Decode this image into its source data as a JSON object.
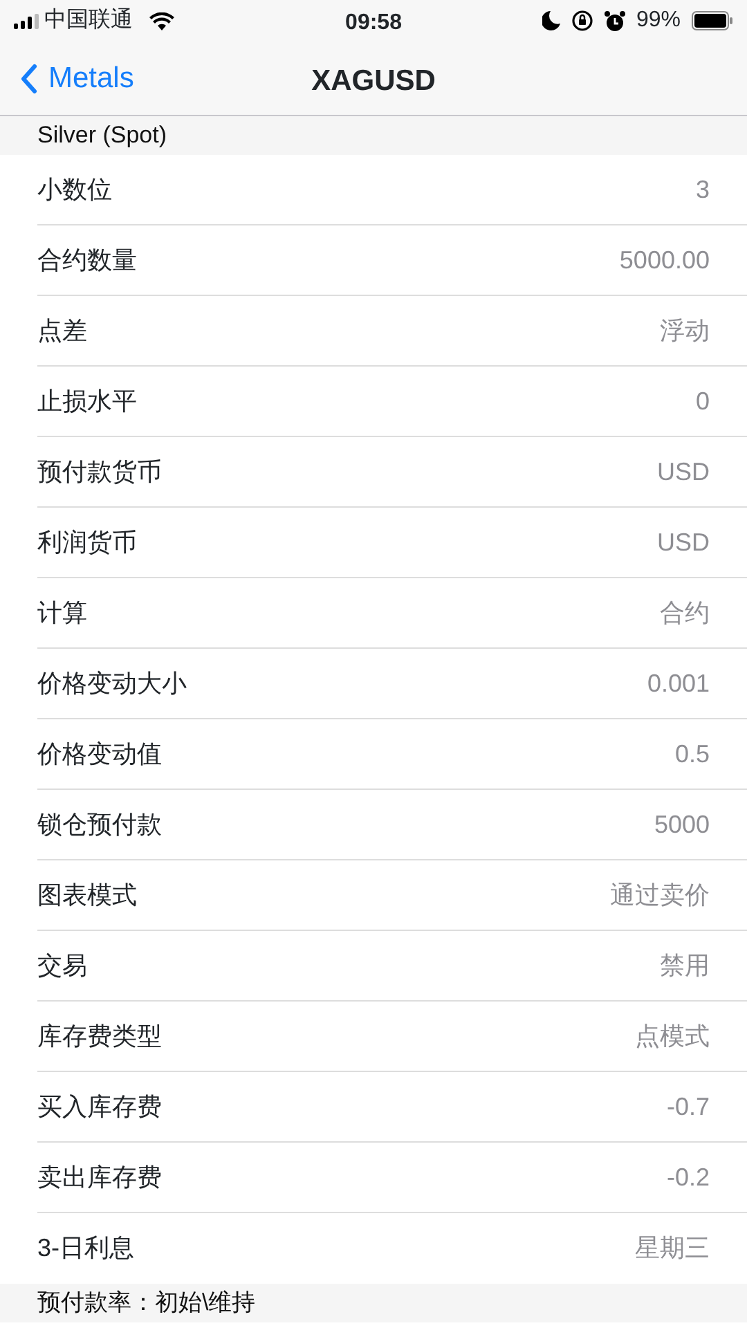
{
  "status_bar": {
    "carrier": "中国联通",
    "time": "09:58",
    "battery": "99%"
  },
  "nav_bar": {
    "back": "Metals",
    "title": "XAGUSD"
  },
  "sections": [
    {
      "header": "Silver (Spot)",
      "rows": [
        {
          "label": "小数位",
          "value": "3"
        },
        {
          "label": "合约数量",
          "value": "5000.00"
        },
        {
          "label": "点差",
          "value": "浮动"
        },
        {
          "label": "止损水平",
          "value": "0"
        },
        {
          "label": "预付款货币",
          "value": "USD"
        },
        {
          "label": "利润货币",
          "value": "USD"
        },
        {
          "label": "计算",
          "value": "合约"
        },
        {
          "label": "价格变动大小",
          "value": "0.001"
        },
        {
          "label": "价格变动值",
          "value": "0.5"
        },
        {
          "label": "锁仓预付款",
          "value": "5000"
        },
        {
          "label": "图表模式",
          "value": "通过卖价"
        },
        {
          "label": "交易",
          "value": "禁用"
        },
        {
          "label": "库存费类型",
          "value": "点模式"
        },
        {
          "label": "买入库存费",
          "value": "-0.7"
        },
        {
          "label": "卖出库存费",
          "value": "-0.2"
        },
        {
          "label": "3-日利息",
          "value": "星期三"
        }
      ]
    },
    {
      "header": "预付款率：初始\\维持"
    }
  ]
}
